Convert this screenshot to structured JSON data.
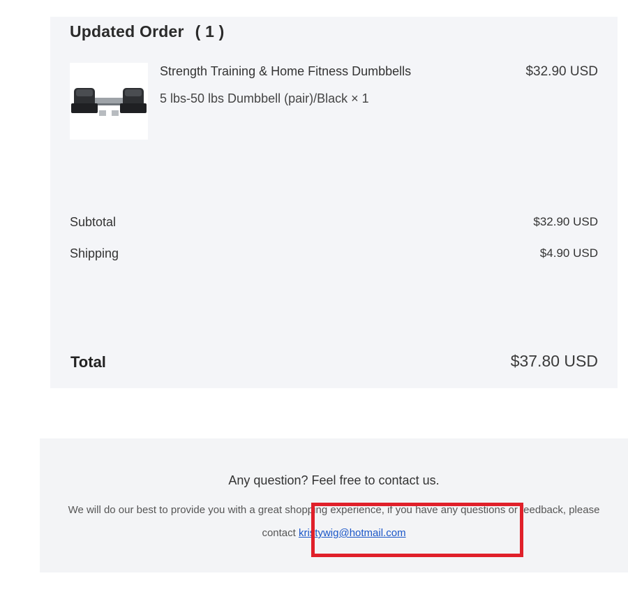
{
  "order": {
    "title": "Updated Order",
    "count": "( 1 )",
    "item": {
      "name": "Strength Training & Home Fitness Dumbbells",
      "variant": "5 lbs-50 lbs Dumbbell (pair)/Black × 1",
      "price": "$32.90 USD",
      "image_icon": "dumbbell-icon"
    },
    "subtotal_label": "Subtotal",
    "subtotal_value": "$32.90 USD",
    "shipping_label": "Shipping",
    "shipping_value": "$4.90 USD",
    "total_label": "Total",
    "total_value": "$37.80 USD"
  },
  "footer": {
    "heading": "Any question? Feel free to contact us.",
    "text_before": "We will do our best to provide you with a great shopping experience, if you have any questions or feedback, please contact ",
    "email": "kristywig@hotmail.com"
  },
  "colors": {
    "highlight_box": "#e0202a",
    "link": "#1a56c8"
  }
}
